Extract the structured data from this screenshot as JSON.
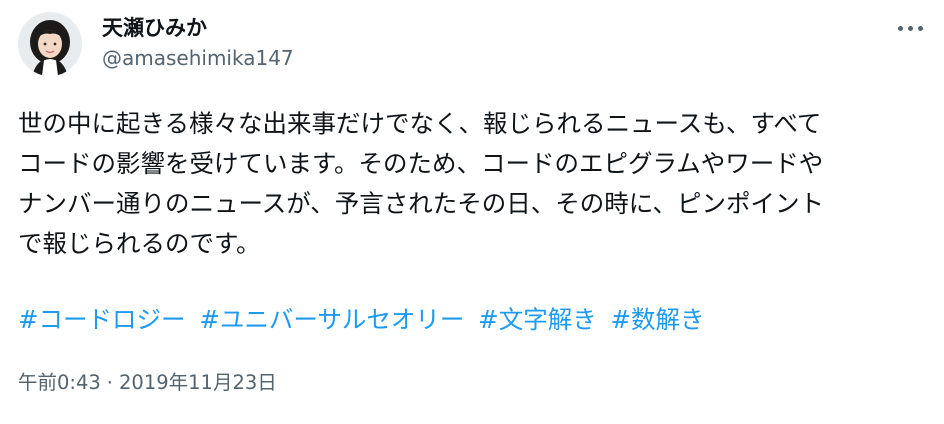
{
  "author": {
    "display_name": "天瀬ひみか",
    "handle": "@amasehimika147",
    "avatar_icon": "user-avatar-photo"
  },
  "more_menu": {
    "icon": "more-horizontal-icon"
  },
  "tweet": {
    "lines": [
      "世の中に起きる様々な出来事だけでなく、報じられるニュースも、すべて",
      "コードの影響を受けています。そのため、コードのエピグラムやワードや",
      "ナンバー通りのニュースが、予言されたその日、その時に、ピンポイント",
      "で報じられるのです。"
    ],
    "hashtags": [
      "#コードロジー",
      "#ユニバーサルセオリー",
      "#文字解き",
      "#数解き"
    ]
  },
  "meta": {
    "time": "午前0:43",
    "separator": "·",
    "date": "2019年11月23日"
  },
  "colors": {
    "text": "#0f1419",
    "secondary": "#536471",
    "link": "#1d9bf0"
  }
}
